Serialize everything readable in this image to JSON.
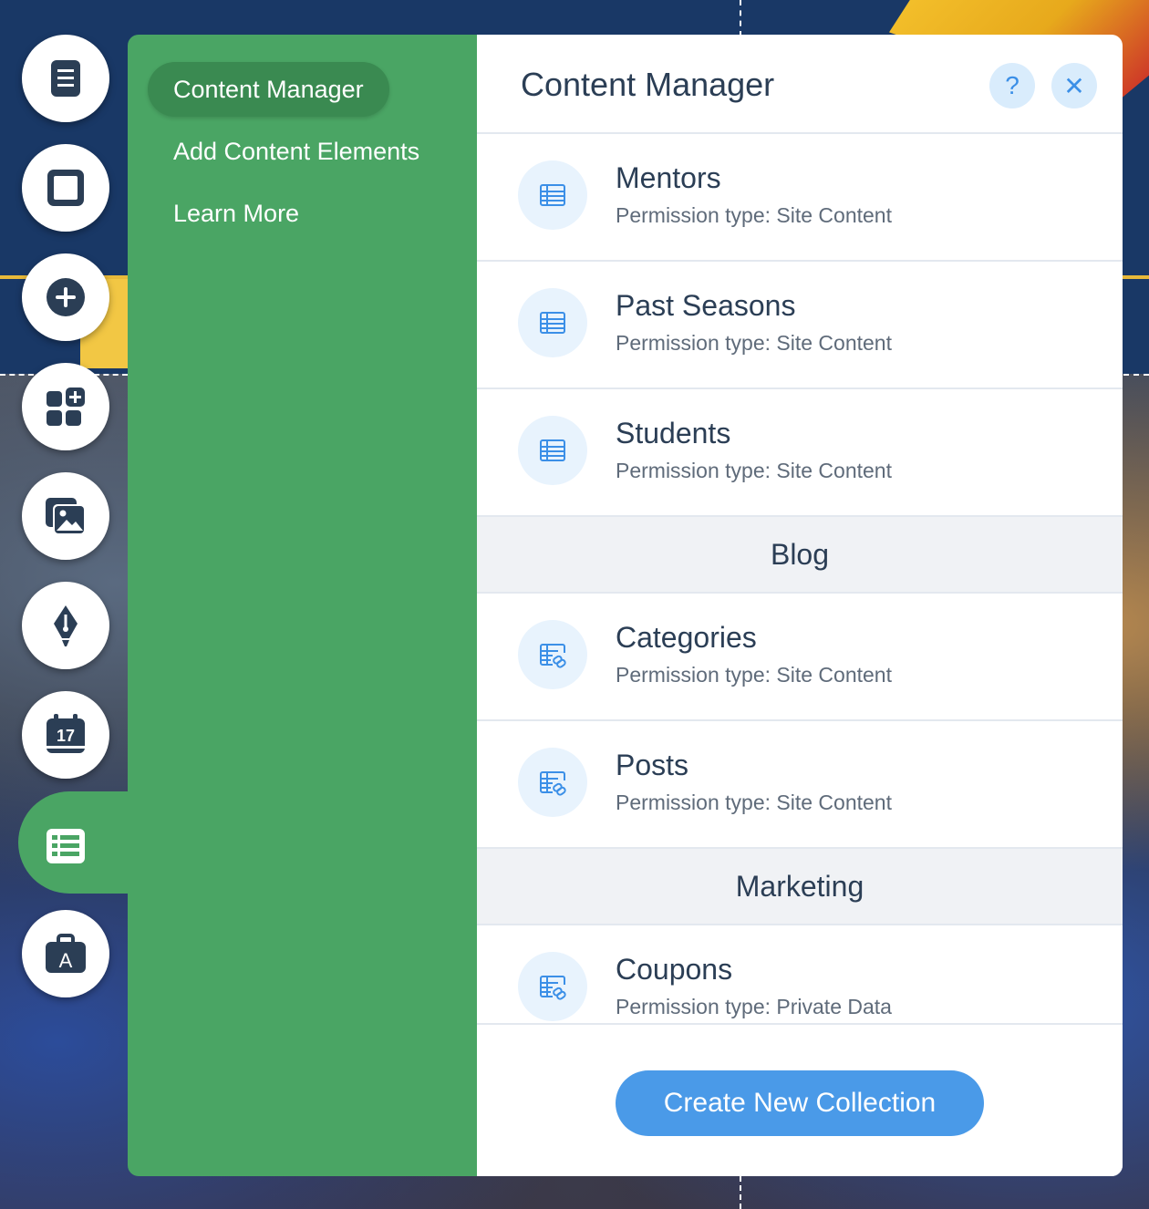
{
  "toolbar": {
    "items": [
      {
        "icon": "pages-icon"
      },
      {
        "icon": "background-icon"
      },
      {
        "icon": "add-icon"
      },
      {
        "icon": "add-apps-icon"
      },
      {
        "icon": "media-icon"
      },
      {
        "icon": "blog-pen-icon"
      },
      {
        "icon": "calendar-icon",
        "text": "17"
      },
      {
        "icon": "database-icon",
        "active": true
      },
      {
        "icon": "app-market-icon",
        "text": "A"
      }
    ]
  },
  "sidenav": {
    "items": [
      {
        "label": "Content Manager",
        "active": true
      },
      {
        "label": "Add Content Elements"
      },
      {
        "label": "Learn More"
      }
    ]
  },
  "panel": {
    "title": "Content Manager",
    "help_icon": "?",
    "close_icon": "✕",
    "groups": [
      {
        "section": "",
        "collections": [
          {
            "name": "Mentors",
            "permission": "Permission type: Site Content",
            "icon": "collection-icon"
          },
          {
            "name": "Past Seasons",
            "permission": "Permission type: Site Content",
            "icon": "collection-icon"
          },
          {
            "name": "Students",
            "permission": "Permission type: Site Content",
            "icon": "collection-icon"
          }
        ]
      },
      {
        "section": "Blog",
        "collections": [
          {
            "name": "Categories",
            "permission": "Permission type: Site Content",
            "icon": "linked-collection-icon"
          },
          {
            "name": "Posts",
            "permission": "Permission type: Site Content",
            "icon": "linked-collection-icon"
          }
        ]
      },
      {
        "section": "Marketing",
        "collections": [
          {
            "name": "Coupons",
            "permission": "Permission type: Private Data",
            "icon": "linked-collection-icon"
          }
        ]
      }
    ],
    "create_button": "Create New Collection"
  },
  "colors": {
    "sidenav_bg": "#4aa564",
    "sidenav_active": "#3a8a51",
    "primary_button": "#4a9ae8",
    "icon_bg": "#e8f3fd",
    "text_dark": "#2b3e55"
  }
}
